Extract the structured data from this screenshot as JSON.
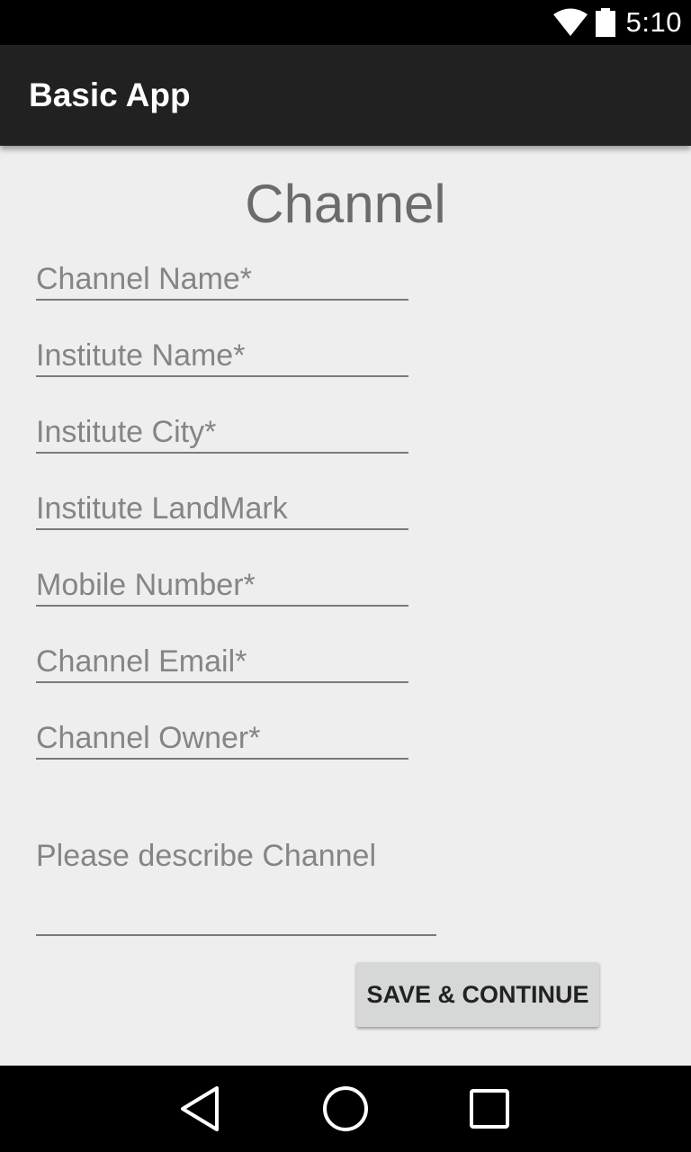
{
  "status_bar": {
    "time": "5:10",
    "icons": [
      "wifi-icon",
      "battery-icon"
    ]
  },
  "app_bar": {
    "title": "Basic App"
  },
  "form": {
    "title": "Channel",
    "fields": [
      {
        "placeholder": "Channel Name*",
        "value": ""
      },
      {
        "placeholder": "Institute Name*",
        "value": ""
      },
      {
        "placeholder": "Institute City*",
        "value": ""
      },
      {
        "placeholder": "Institute LandMark",
        "value": ""
      },
      {
        "placeholder": "Mobile Number*",
        "value": ""
      },
      {
        "placeholder": "Channel Email*",
        "value": ""
      },
      {
        "placeholder": "Channel Owner*",
        "value": ""
      }
    ],
    "description": {
      "placeholder": "Please describe Channel",
      "value": ""
    },
    "save_label": "SAVE & CONTINUE"
  },
  "nav_bar": {
    "icons": [
      "back-icon",
      "home-icon",
      "recents-icon"
    ]
  },
  "colors": {
    "status_bar": "#000000",
    "app_bar": "#212121",
    "background": "#eeeeee",
    "button": "#d6d7d7",
    "nav_bar": "#000000"
  }
}
